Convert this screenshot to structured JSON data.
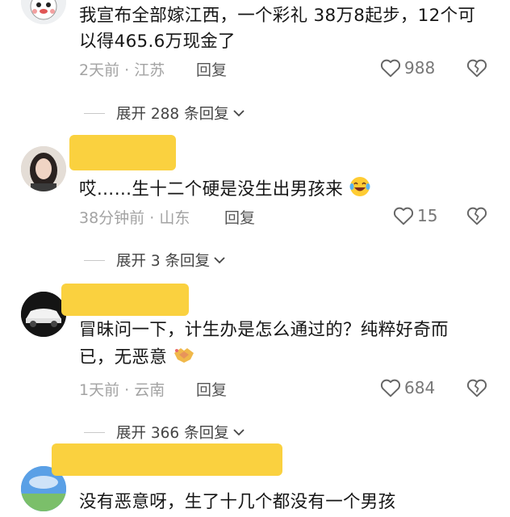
{
  "comments": [
    {
      "text": "我宣布全部嫁江西，一个彩礼 38万8起步，12个可以得465.6万现金了",
      "time": "2天前",
      "location": "江苏",
      "reply_label": "回复",
      "likes": "988",
      "expand_label": "展开 288 条回复"
    },
    {
      "text": "哎……生十二个硬是没生出男孩来",
      "time": "38分钟前",
      "location": "山东",
      "reply_label": "回复",
      "likes": "15",
      "expand_label": "展开 3 条回复"
    },
    {
      "text": "冒昧问一下，计生办是怎么通过的？纯粹好奇而已，无恶意",
      "time": "1天前",
      "location": "云南",
      "reply_label": "回复",
      "likes": "684",
      "expand_label": "展开 366 条回复"
    },
    {
      "text": "没有恶意呀，生了十几个都没有一个男孩"
    }
  ],
  "sep": "·",
  "colors": {
    "redact": "#fad13f",
    "meta": "#a3a3a3"
  }
}
